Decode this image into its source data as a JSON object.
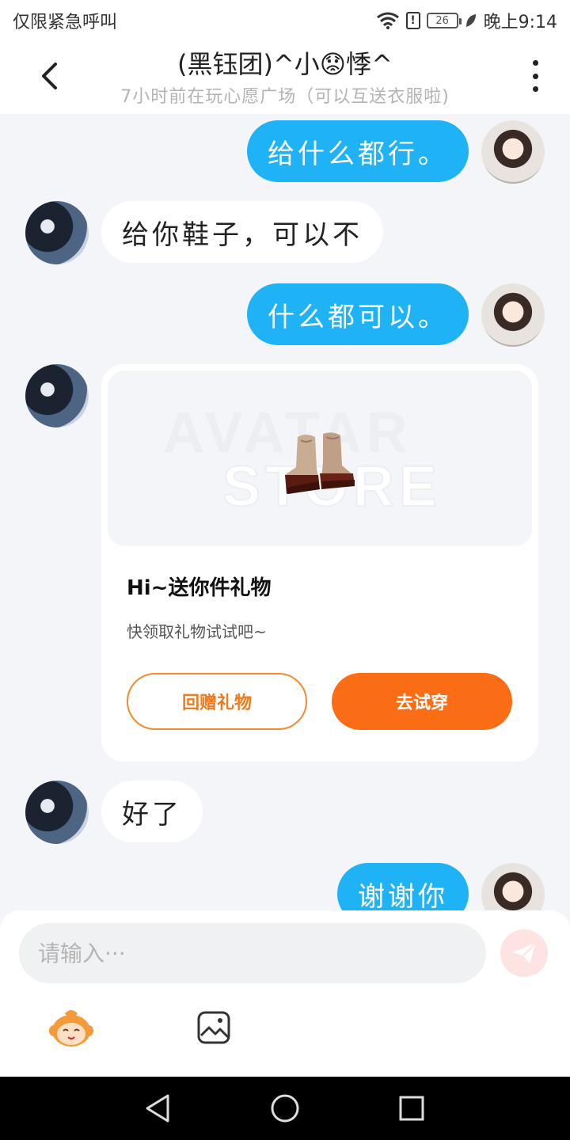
{
  "status_bar": {
    "carrier_text": "仅限紧急呼叫",
    "battery": "26",
    "time": "晚上9:14"
  },
  "header": {
    "title": "(黑钰团)^小😟悸^",
    "subtitle": "7小时前在玩心愿广场（可以互送衣服啦)"
  },
  "messages": [
    {
      "from": "me",
      "text": "给什么都行。"
    },
    {
      "from": "other",
      "text": "给你鞋子，可以不"
    },
    {
      "from": "me",
      "text": "什么都可以。"
    },
    {
      "from": "other",
      "type": "gift"
    },
    {
      "from": "other",
      "text": "好了"
    },
    {
      "from": "me",
      "text": "谢谢你"
    }
  ],
  "gift_card": {
    "watermark_line1": "AVATAR",
    "watermark_line2": "STORE",
    "title": "Hi~送你件礼物",
    "description": "快领取礼物试试吧~",
    "return_button": "回赠礼物",
    "try_button": "去试穿"
  },
  "input": {
    "placeholder": "请输入···"
  },
  "colors": {
    "my_bubble": "#1fb3f5",
    "accent_orange": "#fb6d15",
    "background": "#f3f5f8"
  }
}
